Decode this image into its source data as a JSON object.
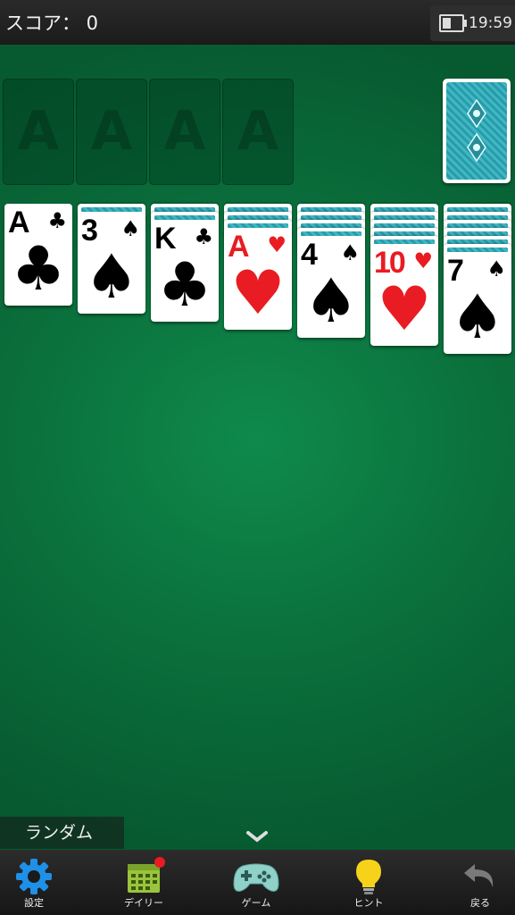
{
  "topbar": {
    "score_label": "スコア： 0",
    "time": "19:59"
  },
  "foundations": [
    "A",
    "A",
    "A",
    "A"
  ],
  "tableau": [
    {
      "rank": "A",
      "suit": "♣",
      "color": "black",
      "hidden": 0
    },
    {
      "rank": "3",
      "suit": "♠",
      "color": "black",
      "hidden": 1
    },
    {
      "rank": "K",
      "suit": "♣",
      "color": "black",
      "hidden": 2
    },
    {
      "rank": "A",
      "suit": "♥",
      "color": "red",
      "hidden": 3
    },
    {
      "rank": "4",
      "suit": "♠",
      "color": "black",
      "hidden": 4
    },
    {
      "rank": "10",
      "suit": "♥",
      "color": "red",
      "hidden": 5
    },
    {
      "rank": "7",
      "suit": "♠",
      "color": "black",
      "hidden": 6
    }
  ],
  "mode_label": "ランダム",
  "nav": {
    "settings": "設定",
    "daily": "デイリー",
    "games": "ゲーム",
    "hint": "ヒント",
    "back": "戻る"
  },
  "colors": {
    "felt": "#0a6e3b",
    "red_suit": "#e81c22",
    "card_back": "#3eb8c4",
    "settings_icon": "#1e90e8",
    "hint_icon": "#f7d21b"
  }
}
